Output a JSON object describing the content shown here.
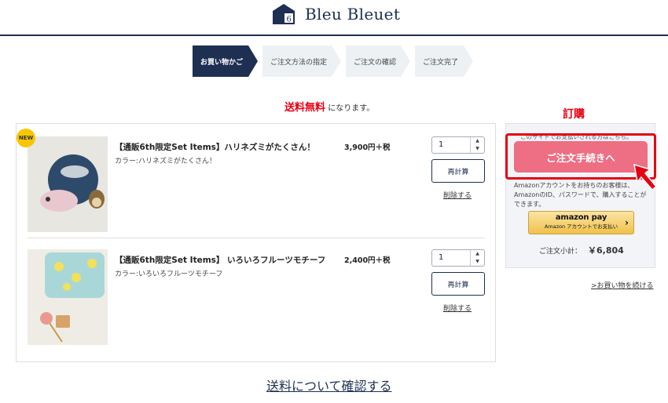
{
  "header": {
    "brand": "Bleu Bleuet"
  },
  "steps": [
    {
      "label": "お買い物かご",
      "active": true
    },
    {
      "label": "ご注文方法の指定",
      "active": false
    },
    {
      "label": "ご注文の確認",
      "active": false
    },
    {
      "label": "ご注文完了",
      "active": false
    }
  ],
  "notice": {
    "highlight": "送料無料",
    "text": "になります。"
  },
  "annotation": "訂購",
  "cart": {
    "items": [
      {
        "badge": "NEW",
        "name": "【通販6th限定Set Items】ハリネズミがたくさん！",
        "color": "カラー:ハリネズミがたくさん！",
        "price": "3,900円＋税",
        "qty": "1",
        "recalc": "再計算",
        "delete": "削除する"
      },
      {
        "badge": "",
        "name": "【通販6th限定Set Items】 いろいろフルーツモチーフ",
        "color": "カラー:いろいろフルーツモチーフ",
        "price": "2,400円＋税",
        "qty": "1",
        "recalc": "再計算",
        "delete": "削除する"
      }
    ]
  },
  "panel": {
    "top_note": "このサイトでお支払いされる方はこちら。",
    "checkout": "ご注文手続きへ",
    "amazon_note": "Amazonアカウントをお持ちのお客様は、AmazonのID、パスワードで、購入することができます。",
    "amazon_logo": "amazon pay",
    "amazon_sub": "Amazon アカウントでお支払い",
    "amazon_chevron": "›",
    "subtotal_label": "ご注文小計：",
    "subtotal_value": "￥6,804"
  },
  "continue_link": ">お買い物を続ける",
  "shipping_link": "送料について確認する",
  "colors": {
    "navy": "#1e2f52",
    "checkout_pink": "#ee6e83",
    "red": "#e60012",
    "badge_yellow": "#f7c600"
  },
  "icons": [
    "logo-house-icon",
    "spinner-up-icon",
    "spinner-down-icon",
    "red-arrow-icon"
  ]
}
